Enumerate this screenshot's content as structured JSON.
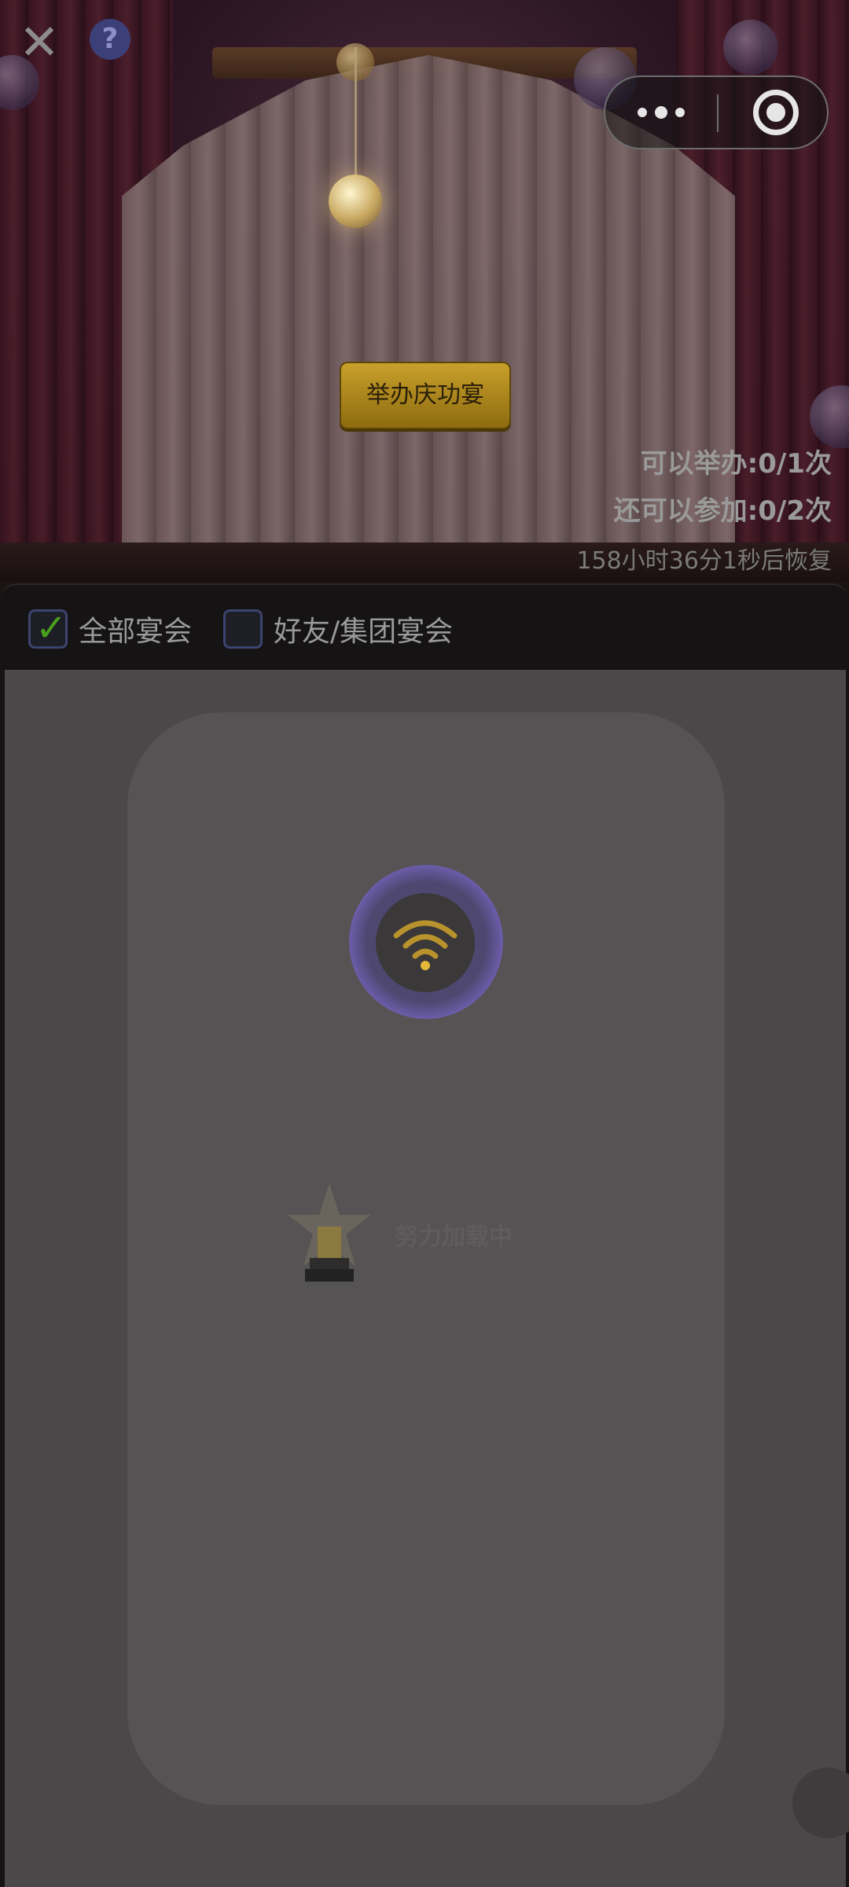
{
  "window": {
    "close_icon": "close-icon",
    "help_icon": "help-icon",
    "help_glyph": "?",
    "close_glyph": "✕"
  },
  "capsule": {
    "more_icon": "more-dots-icon",
    "target_icon": "target-icon"
  },
  "stage": {
    "host_button_label": "举办庆功宴",
    "can_host": "可以举办:0/1次",
    "can_join": "还可以参加:0/2次",
    "recover_timer": "158小时36分1秒后恢复"
  },
  "filters": [
    {
      "label": "全部宴会",
      "checked": true
    },
    {
      "label": "好友/集团宴会",
      "checked": false
    }
  ],
  "loading": {
    "icon": "wifi-icon",
    "trophy_icon": "trophy-icon",
    "text": "努力加载中"
  },
  "colors": {
    "accent_gold": "#c8a02a",
    "check_green": "#4aa01c",
    "loader_purple": "#6a5ca8"
  }
}
